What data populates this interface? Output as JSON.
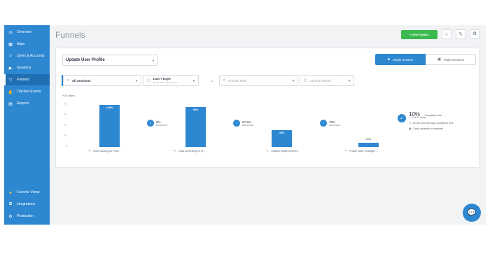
{
  "sidebar": {
    "items": [
      {
        "label": "Overview",
        "icon": "clock-icon"
      },
      {
        "label": "Apps",
        "icon": "grid-icon"
      },
      {
        "label": "Users & Accounts",
        "icon": "user-icon"
      },
      {
        "label": "Sessions",
        "icon": "play-icon"
      },
      {
        "label": "Funnels",
        "icon": "funnel-icon"
      },
      {
        "label": "Tracked Events",
        "icon": "tracked-events-icon"
      },
      {
        "label": "Reports",
        "icon": "document-icon"
      }
    ],
    "bottom_items": [
      {
        "label": "Favorite Views",
        "icon": "star-icon"
      },
      {
        "label": "Integrations",
        "icon": "integrations-icon"
      },
      {
        "label": "Production",
        "icon": "gear-icon"
      }
    ],
    "active": "Funnels"
  },
  "header": {
    "title": "Funnels",
    "new_funnel_label": "+ NEW FUNNEL"
  },
  "funnel_select": {
    "value": "Update User Profile"
  },
  "view_toggle": {
    "single": "Single Session",
    "total": "Total Sessions",
    "active": "Single Session"
  },
  "filters": {
    "sessions": "All Sessions",
    "date_range": "Last 7 Days",
    "date_sub": "May 18, 2021 – May 24, 2021",
    "vs": "vs",
    "compare_filter_placeholder": "Choose Filter",
    "compare_period_placeholder": "Choose Period"
  },
  "chart_data": {
    "type": "bar",
    "ylabel": "% of Users",
    "categories": [
      "User clicking on Profi...",
      "Click something in jir...",
      "Clicked profile element",
      "Profile Save Changes ..."
    ],
    "values": [
      100,
      95,
      40,
      10
    ],
    "value_labels": [
      "100%",
      "95%",
      "40%",
      "10%"
    ],
    "ylim": [
      0,
      100
    ],
    "dropoffs": [
      {
        "pct": "6%",
        "label": "DROPPED"
      },
      {
        "pct": "57.9%",
        "label": "DROPPED"
      },
      {
        "pct": "75%",
        "label": "DROPPED"
      }
    ]
  },
  "summary": {
    "rate": "10%",
    "rate_label": "Completion rate",
    "users": "2 of 21 users",
    "avg_time": "2d 23h 42m 26s avg. completion time",
    "sessions": "2 avg. sessions to complete"
  },
  "colors": {
    "accent": "#2d87d1",
    "green": "#3cb94f",
    "sidebar": "#2d87d1"
  }
}
